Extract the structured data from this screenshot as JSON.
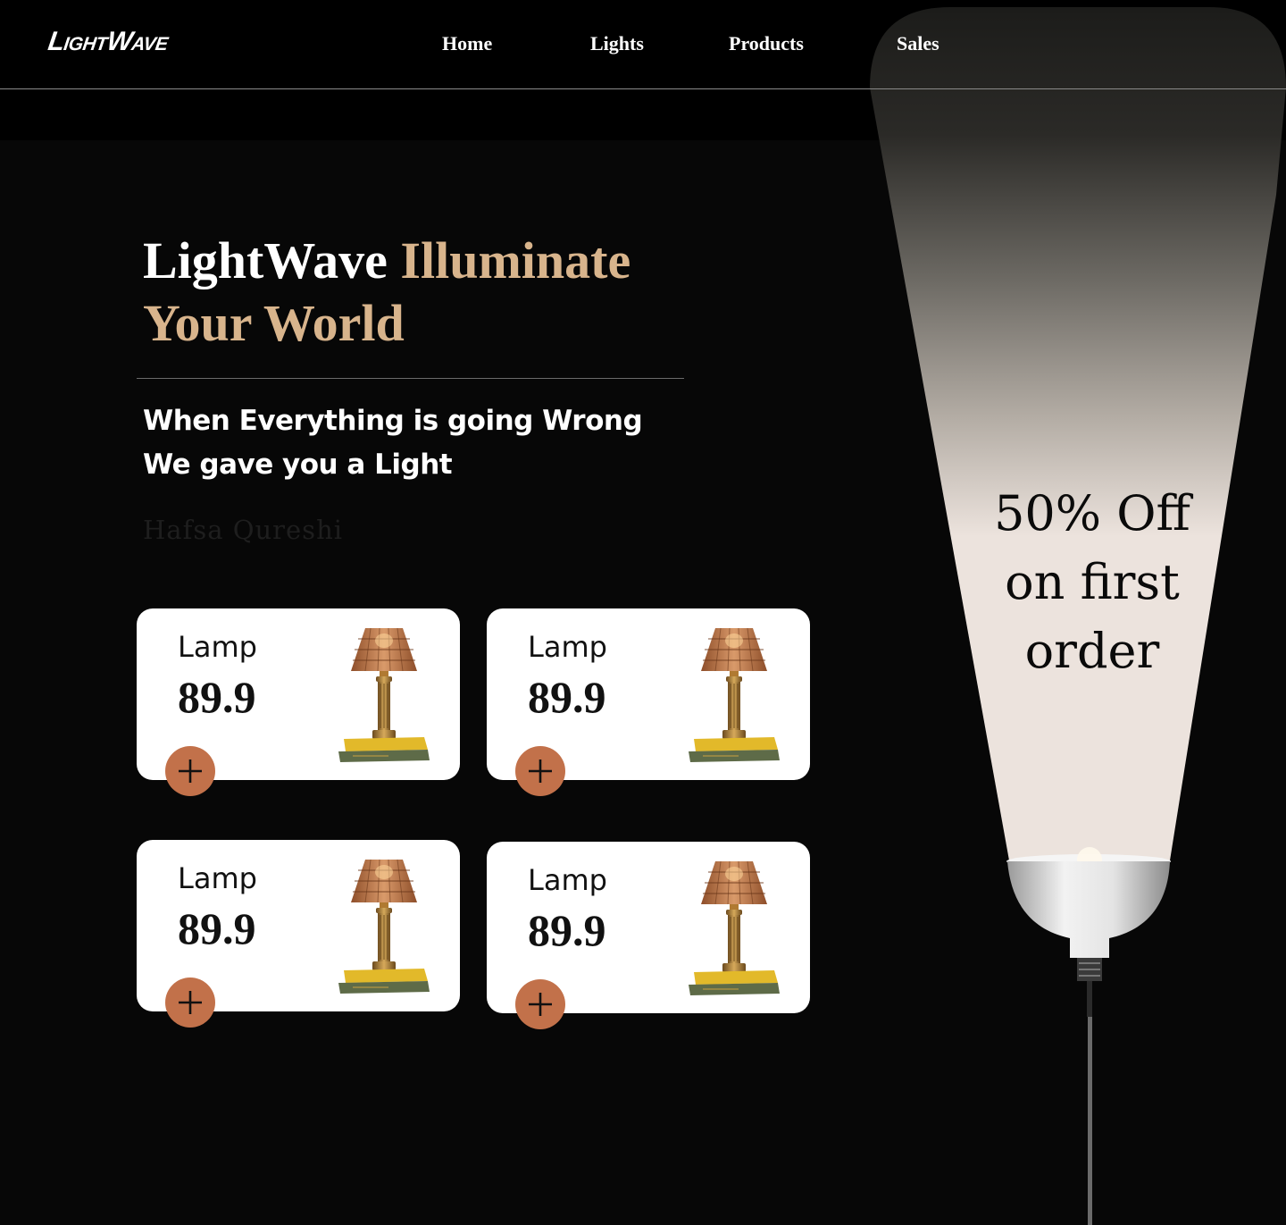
{
  "brand": {
    "logo": "LightWave"
  },
  "nav": {
    "items": [
      {
        "label": "Home"
      },
      {
        "label": "Lights"
      },
      {
        "label": "Products"
      },
      {
        "label": "Sales"
      }
    ]
  },
  "hero": {
    "title_plain": "LightWave ",
    "title_accent": "Illuminate Your World",
    "tagline_line1": "When Everything is going Wrong",
    "tagline_line2": "We gave you a Light",
    "author": "Hafsa Qureshi"
  },
  "products": [
    {
      "name": "Lamp",
      "price": "89.9",
      "add_icon": "plus-icon"
    },
    {
      "name": "Lamp",
      "price": "89.9",
      "add_icon": "plus-icon"
    },
    {
      "name": "Lamp",
      "price": "89.9",
      "add_icon": "plus-icon"
    },
    {
      "name": "Lamp",
      "price": "89.9",
      "add_icon": "plus-icon"
    }
  ],
  "promo": {
    "line1": "50% Off",
    "line2": "on first",
    "line3": "order"
  },
  "colors": {
    "background": "#070707",
    "accent_gold": "#d8b48c",
    "add_button": "#c2714a",
    "beam_light": "#ece3dd"
  }
}
